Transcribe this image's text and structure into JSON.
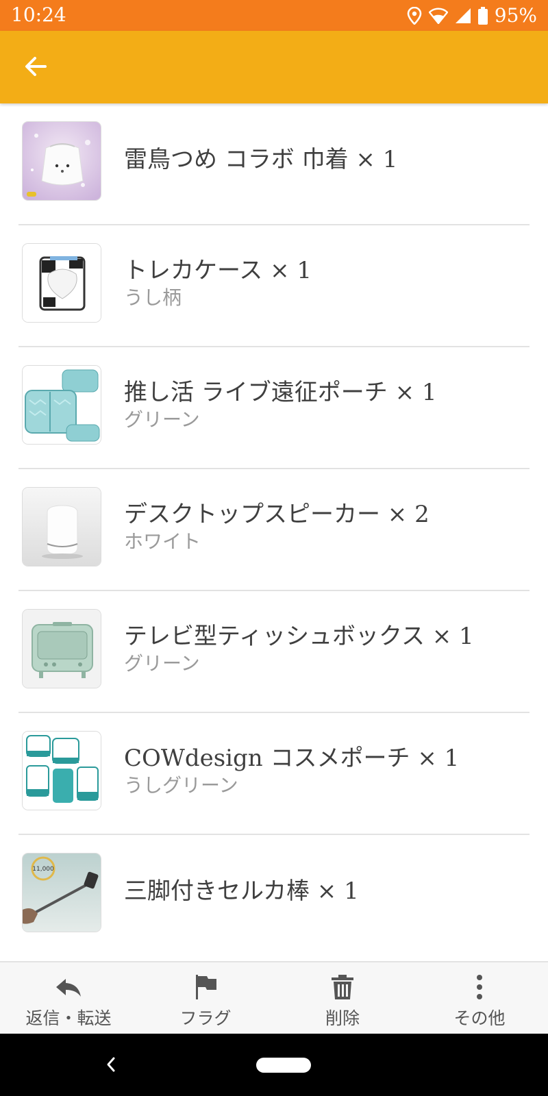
{
  "status_bar": {
    "time": "10:24",
    "battery": "95%",
    "icons": [
      "location-icon",
      "wifi-icon",
      "signal-icon",
      "battery-icon"
    ]
  },
  "app_bar": {
    "back_icon": "arrow-back-icon",
    "color": "#f3ad16"
  },
  "items": [
    {
      "title": "雷鳥つめ コラボ 巾着 × 1",
      "subtitle": ""
    },
    {
      "title": "トレカケース × 1",
      "subtitle": "うし柄"
    },
    {
      "title": "推し活 ライブ遠征ポーチ × 1",
      "subtitle": "グリーン"
    },
    {
      "title": "デスクトップスピーカー × 2",
      "subtitle": "ホワイト"
    },
    {
      "title": "テレビ型ティッシュボックス × 1",
      "subtitle": "グリーン"
    },
    {
      "title": "COWdesign コスメポーチ × 1",
      "subtitle": "うしグリーン"
    },
    {
      "title": "三脚付きセルカ棒 × 1",
      "subtitle": "",
      "badge": "11,000"
    }
  ],
  "bottom_nav": [
    {
      "label": "返信・転送",
      "icon": "reply-icon"
    },
    {
      "label": "フラグ",
      "icon": "flag-icon"
    },
    {
      "label": "削除",
      "icon": "trash-icon"
    },
    {
      "label": "その他",
      "icon": "more-vertical-icon"
    }
  ],
  "colors": {
    "status_bar": "#f47c1c",
    "app_bar": "#f3ad16"
  }
}
